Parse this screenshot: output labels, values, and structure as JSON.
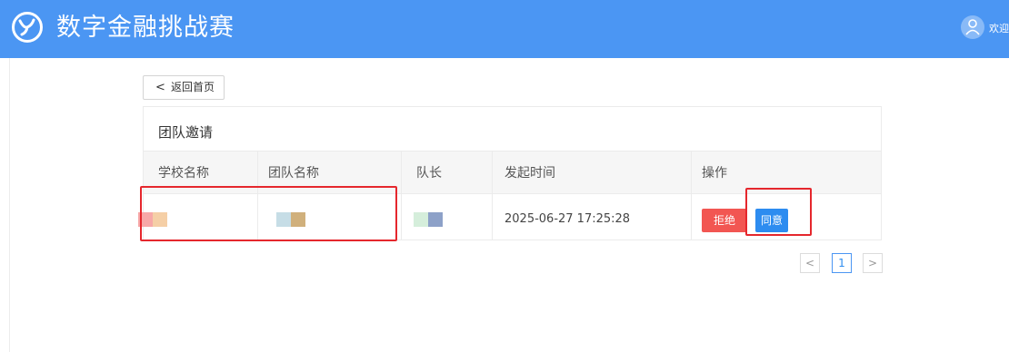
{
  "header": {
    "title": "数字金融挑战赛",
    "welcome_text": "欢迎",
    "bg_color": "#4b96f3"
  },
  "back_button": {
    "icon": "chevron-left-icon",
    "label": "返回首页"
  },
  "panel": {
    "title": "团队邀请",
    "columns": [
      "学校名称",
      "团队名称",
      "队长",
      "发起时间",
      "操作"
    ],
    "rows": [
      {
        "school": "",
        "team": "",
        "captain": "",
        "time": "2025-06-27 17:25:28"
      }
    ],
    "actions": {
      "reject_label": "拒绝",
      "agree_label": "同意",
      "reject_color": "#f25652",
      "agree_color": "#2d8cf0"
    }
  },
  "pagination": {
    "prev": "<",
    "current": "1",
    "next": ">"
  }
}
